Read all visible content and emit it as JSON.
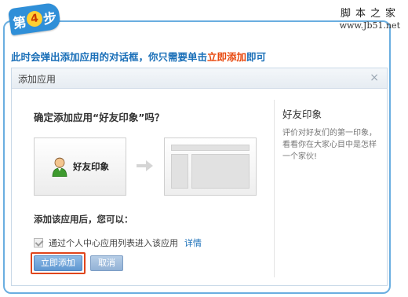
{
  "step": {
    "prefix": "第",
    "number": "4",
    "suffix": "步"
  },
  "watermark": {
    "line1": "脚本之家",
    "line2": "www.Jb51.net"
  },
  "instruction": {
    "before": "此时会弹出添加应用的对话框，你只需要单击",
    "highlight": "立即添加",
    "after": "即可"
  },
  "dialog": {
    "title": "添加应用",
    "close": "×",
    "question": "确定添加应用“好友印象”吗？",
    "app_name": "好友印象",
    "section_label": "添加该应用后，您可以：",
    "checkbox_label": "通过个人中心应用列表进入该应用",
    "detail_link": "详情",
    "add_button": "立即添加",
    "cancel_button": "取消",
    "sidebar": {
      "title": "好友印象",
      "description": "评价对好友们的第一印象，看看你在大家心目中是怎样一个家伙!"
    }
  },
  "colors": {
    "accent": "#1a6fb8",
    "highlight": "#e8470c",
    "frame": "#6aaee0"
  },
  "icons": {
    "avatar": "avatar-icon",
    "arrow": "arrow-right-icon",
    "close": "close-icon"
  }
}
